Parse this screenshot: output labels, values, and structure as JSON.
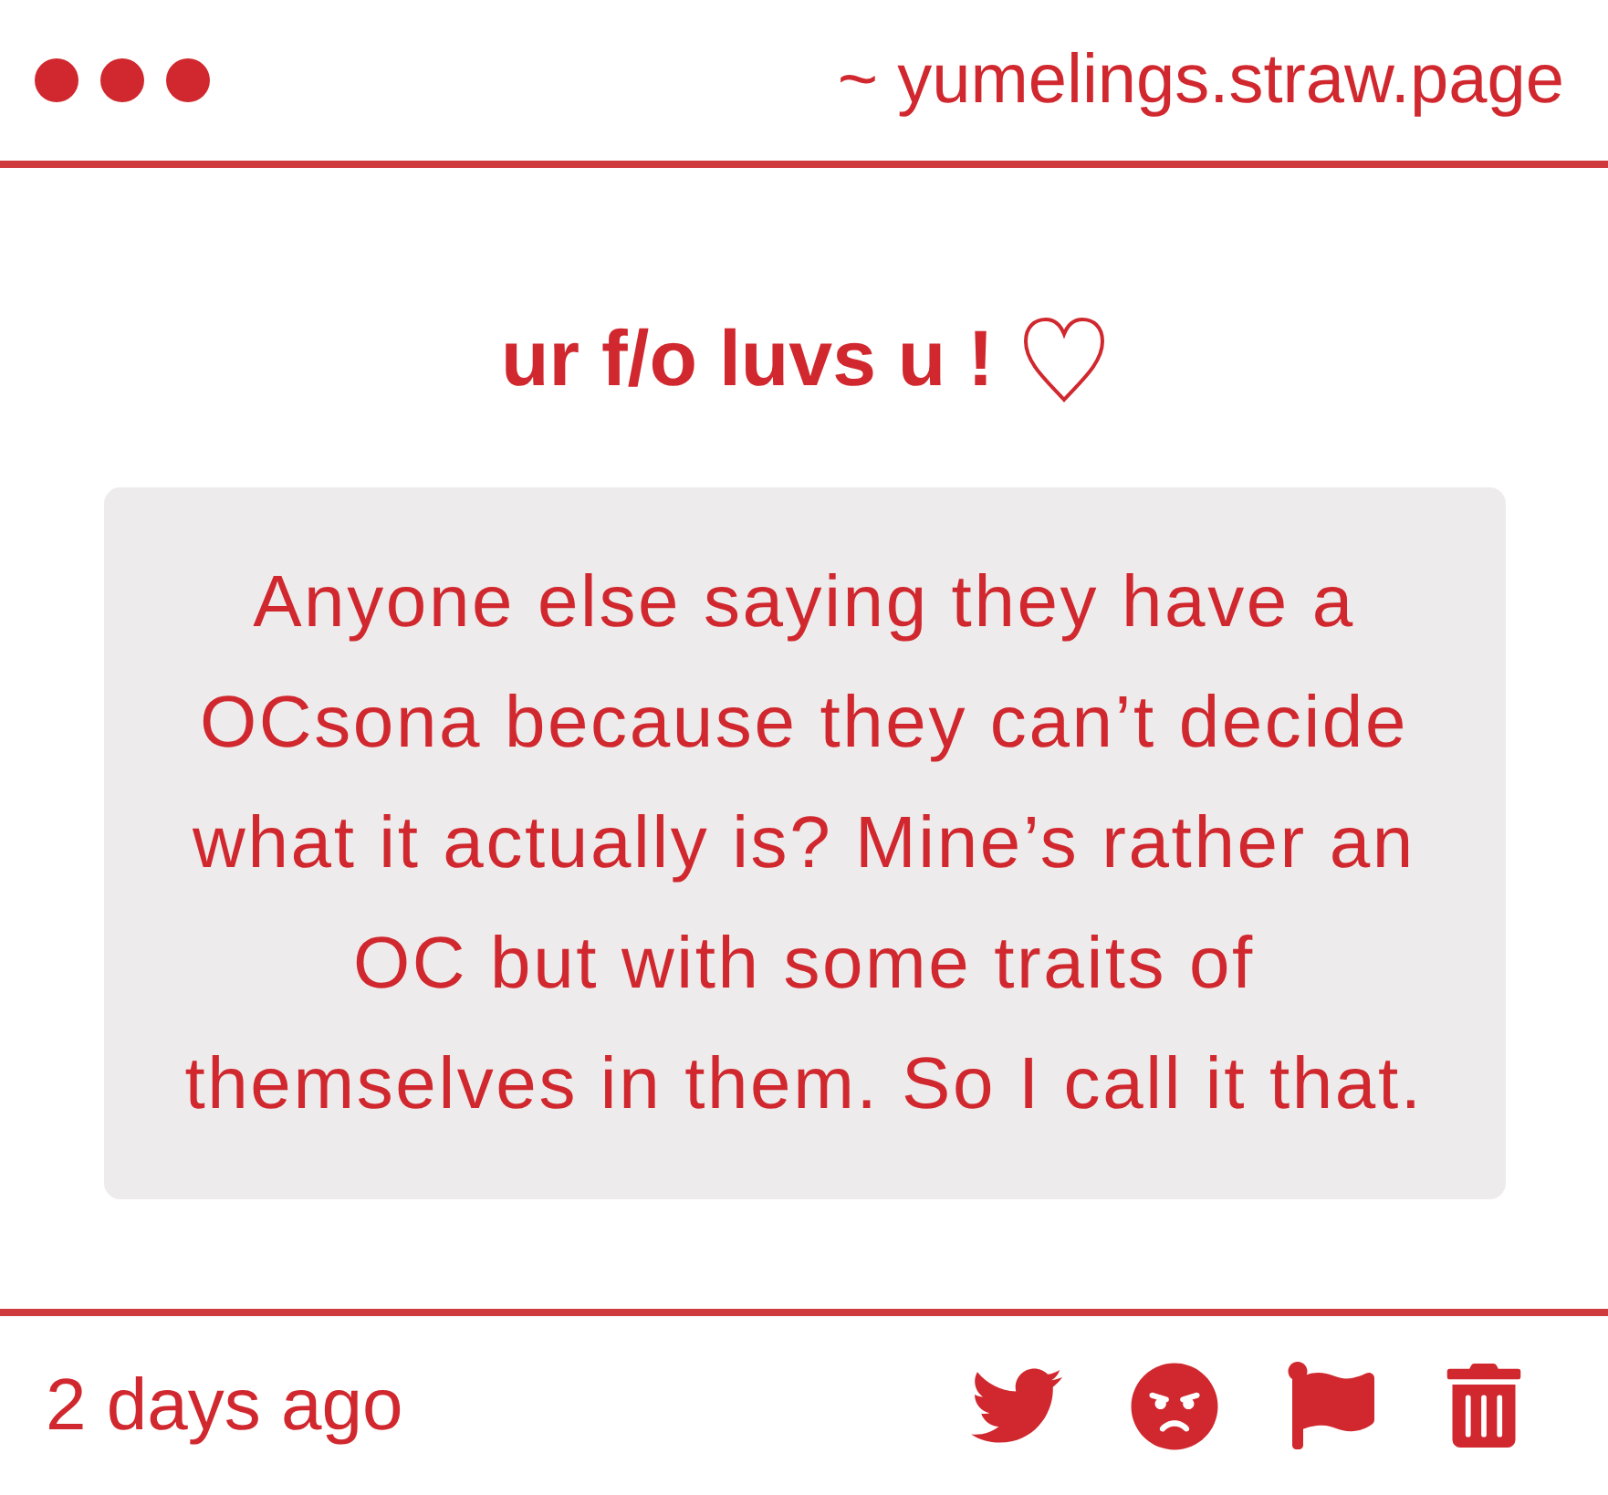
{
  "header": {
    "url": "~ yumelings.straw.page"
  },
  "post": {
    "title": "ur f/o luvs u !",
    "message": "Anyone else saying they have a OCsona because they can’t decide what it actually is? Mine’s rather an OC but with some traits of themselves in them. So I call it that."
  },
  "footer": {
    "time": "2 days ago"
  }
}
